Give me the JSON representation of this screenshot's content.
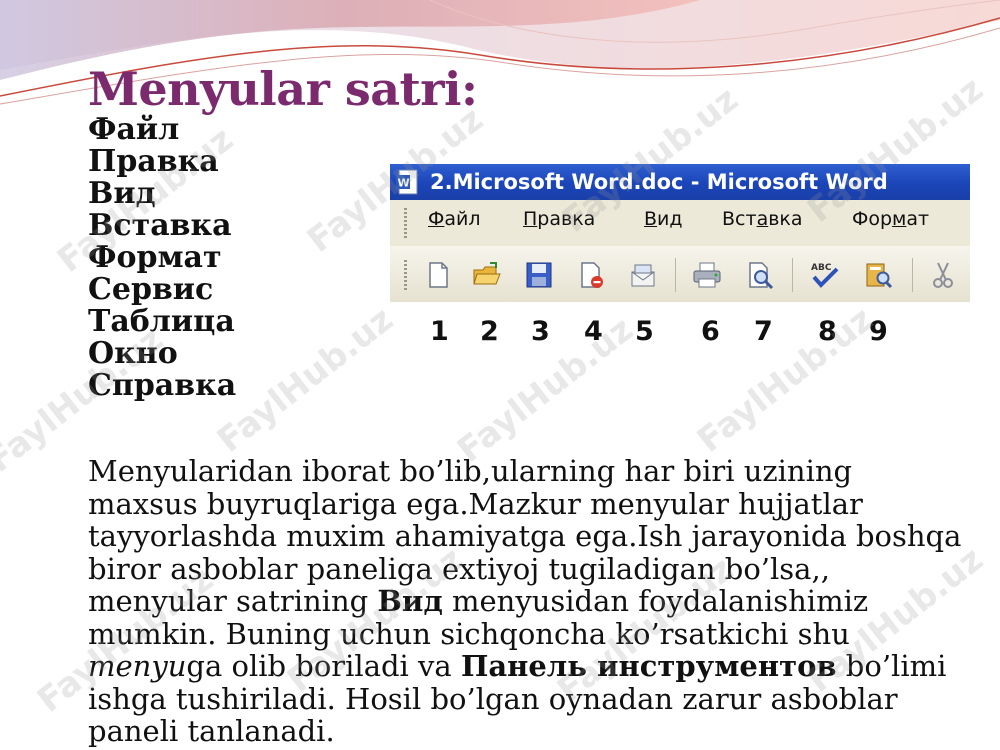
{
  "slide": {
    "title": "Menyular satri:",
    "menu_items": [
      "Файл",
      "Правка",
      "Вид",
      "Вставка",
      "Формат",
      "Сервис",
      "Таблица",
      "Окно",
      "Справка"
    ],
    "paragraph": {
      "p1": "Menyularidan iborat bo’lib,ularning har biri uzining maxsus buyruqlariga ega.Mazkur menyular hujjatlar tayyorlashda muxim ahamiyatga ega.Ish jarayonida boshqa biror asboblar paneliga extiyoj tugiladigan bo’lsa,, menyular satrining ",
      "b1": "Вид",
      "p2": " menyusidan foydalanishimiz mumkin. Buning uchun sichqoncha ko’rsatkichi shu ",
      "i1": "menyu",
      "p3": "ga olib boriladi va ",
      "b2": "Панель инструментов",
      "p4": " bo’limi ishga tushiriladi. Hosil bo’lgan oynadan zarur asboblar paneli tanlanadi."
    },
    "watermark": "FaylHub.uz",
    "colors": {
      "title": "#7b2a6e",
      "titlebar": "#1b45b8",
      "menubar": "#ece9d8"
    }
  },
  "screenshot": {
    "window_title": "2.Microsoft Word.doc - Microsoft Word",
    "menu": [
      {
        "pre": "",
        "u": "Ф",
        "post": "айл"
      },
      {
        "pre": "",
        "u": "П",
        "post": "равка"
      },
      {
        "pre": "",
        "u": "В",
        "post": "ид"
      },
      {
        "pre": "Вст",
        "u": "а",
        "post": "вка"
      },
      {
        "pre": "Фор",
        "u": "м",
        "post": "ат"
      }
    ],
    "toolbar_icons": [
      "new-document-icon",
      "open-folder-icon",
      "save-disk-icon",
      "permission-icon",
      "email-icon",
      "print-icon",
      "print-preview-icon",
      "spelling-icon",
      "research-icon",
      "cut-icon"
    ],
    "numbers": [
      "1",
      "2",
      "3",
      "4",
      "5",
      "6",
      "7",
      "8",
      "9"
    ]
  }
}
